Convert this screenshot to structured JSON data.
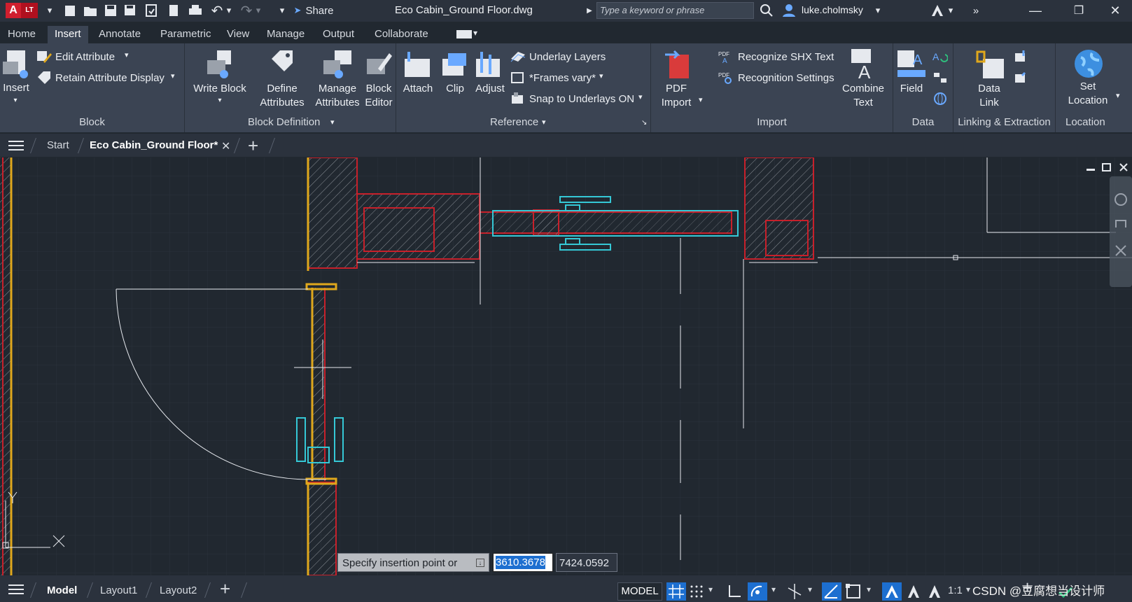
{
  "app": {
    "logo_letter": "A",
    "logo_suffix": "LT",
    "share_label": "Share",
    "document_title": "Eco Cabin_Ground Floor.dwg",
    "search_placeholder": "Type a keyword or phrase",
    "user_name": "luke.cholmsky"
  },
  "menu": {
    "tabs": [
      "Home",
      "Insert",
      "Annotate",
      "Parametric",
      "View",
      "Manage",
      "Output",
      "Collaborate"
    ],
    "active": "Insert"
  },
  "ribbon": {
    "block": {
      "label": "Block",
      "insert": "Insert",
      "edit_attribute": "Edit Attribute",
      "retain_attribute_display": "Retain Attribute Display"
    },
    "block_definition": {
      "label": "Block Definition",
      "write_block": "Write Block",
      "define_attributes": [
        "Define",
        "Attributes"
      ],
      "manage_attributes": [
        "Manage",
        "Attributes"
      ],
      "block_editor": [
        "Block",
        "Editor"
      ]
    },
    "reference": {
      "label": "Reference",
      "attach": "Attach",
      "clip": "Clip",
      "adjust": "Adjust",
      "underlay_layers": "Underlay Layers",
      "frames_vary": "*Frames vary*",
      "snap_to_underlays": "Snap to Underlays ON"
    },
    "import": {
      "label": "Import",
      "pdf_import": [
        "PDF",
        "Import"
      ],
      "recognize_shx": "Recognize SHX Text",
      "recognition_settings": "Recognition Settings",
      "combine_text": [
        "Combine",
        "Text"
      ]
    },
    "data": {
      "label": "Data",
      "field": "Field"
    },
    "linking": {
      "label": "Linking & Extraction",
      "data_link": [
        "Data",
        "Link"
      ]
    },
    "location": {
      "label": "Location",
      "set_location": [
        "Set",
        "Location"
      ]
    }
  },
  "file_tabs": {
    "start": "Start",
    "current": "Eco Cabin_Ground Floor*",
    "add": "+"
  },
  "command": {
    "prompt": "Specify insertion point or",
    "x_value": "3610.3678",
    "y_value": "7424.0592"
  },
  "status": {
    "model_tab": "Model",
    "layouts": [
      "Layout1",
      "Layout2"
    ],
    "model_button": "MODEL",
    "scale": "1:1",
    "watermark": "CSDN @豆腐想当设计师"
  },
  "colors": {
    "wall": "#c8202a",
    "door": "#e0a81c",
    "fixture": "#35c8d6",
    "line": "#e6e9ee",
    "background": "#212830",
    "accent": "#1d6fd0"
  }
}
